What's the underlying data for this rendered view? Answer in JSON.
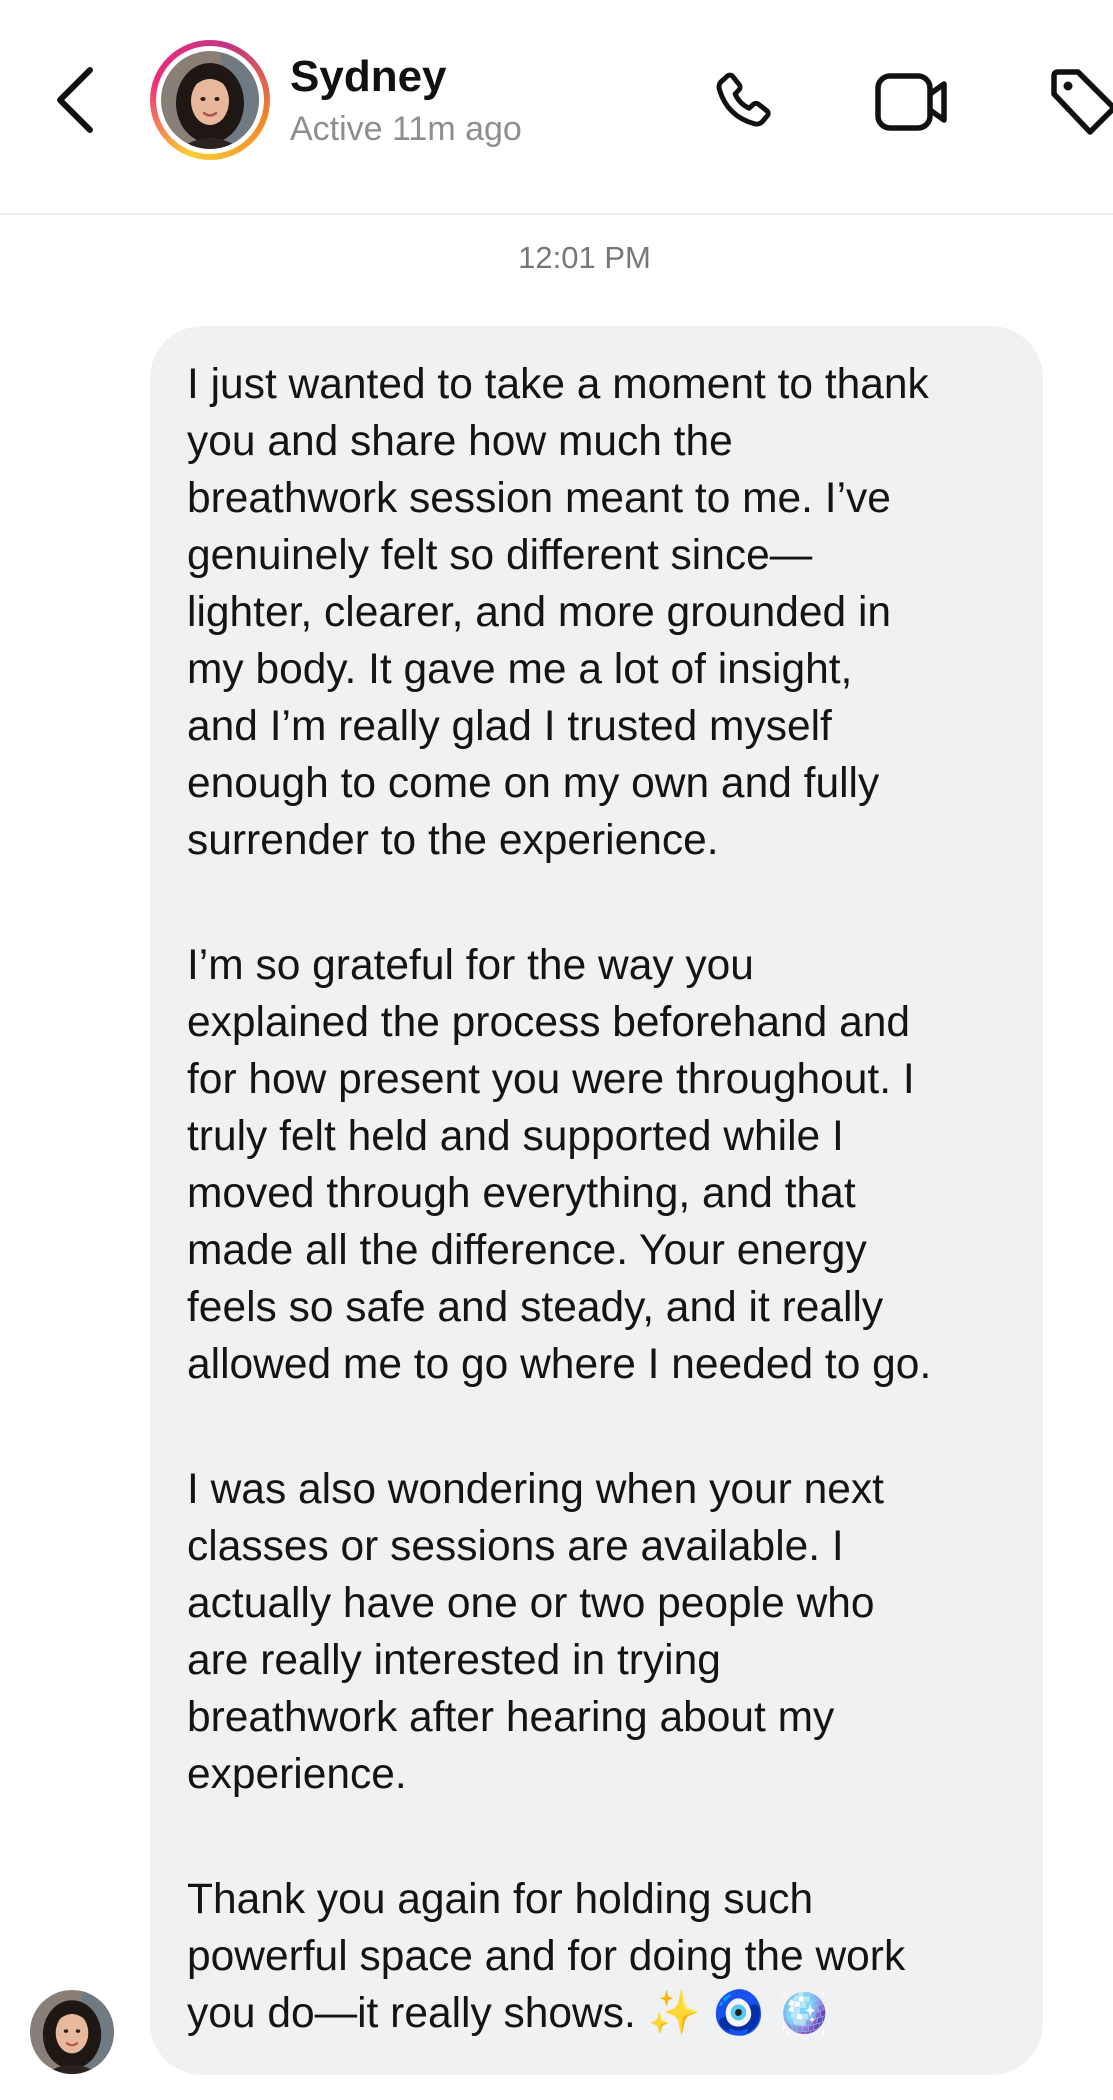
{
  "header": {
    "contact_name": "Sydney",
    "contact_status": "Active 11m ago",
    "icons": [
      "back-icon",
      "phone-icon",
      "video-camera-icon",
      "tag-icon"
    ],
    "story_ring_colors": [
      "#f9ce34",
      "#ee2a7b",
      "#c13584",
      "#f58529"
    ]
  },
  "conversation": {
    "timestamp": "12:01 PM",
    "message": {
      "paragraphs": [
        "I just wanted to take a moment to thank\nyou and share how much the\nbreathwork session meant to me. I’ve\ngenuinely felt so different since—\nlighter, clearer, and more grounded in\nmy body. It gave me a lot of insight,\nand I’m really glad I trusted myself\nenough to come on my own and fully\nsurrender to the experience.",
        "I’m so grateful for the way you\nexplained the process beforehand and\nfor how present you were throughout. I\ntruly felt held and supported while I\nmoved through everything, and that\nmade all the difference. Your energy\nfeels so safe and steady, and it really\nallowed me to go where I needed to go.",
        "I was also wondering when your next\nclasses or sessions are available. I\nactually have one or two people who\nare really interested in trying\nbreathwork after hearing about my\nexperience.",
        "Thank you again for holding such\npowerful space and for doing the work\nyou do—it really shows. ✨ 🧿 🪩"
      ],
      "bubble_color": "#f0f1f3"
    }
  }
}
